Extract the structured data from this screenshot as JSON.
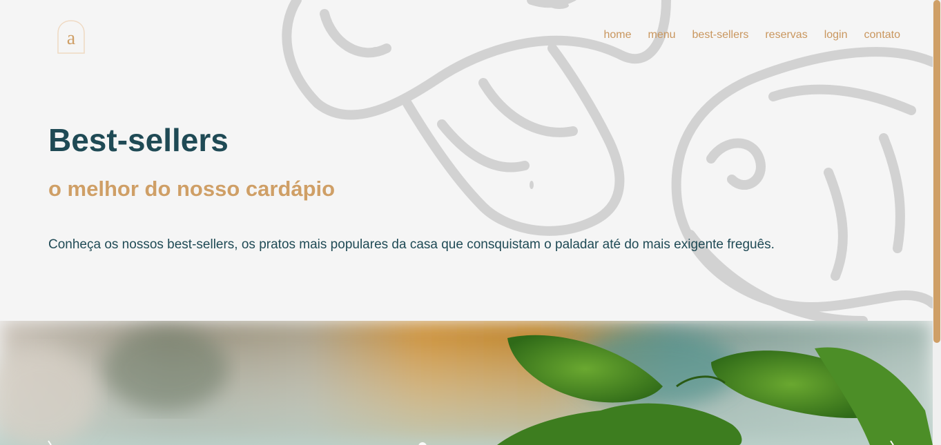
{
  "logo": {
    "letter": "a",
    "icon": "a-monogram-logo-icon"
  },
  "nav": {
    "items": [
      {
        "label": "home"
      },
      {
        "label": "menu"
      },
      {
        "label": "best-sellers"
      },
      {
        "label": "reservas"
      },
      {
        "label": "login"
      },
      {
        "label": "contato"
      }
    ]
  },
  "hero": {
    "title": "Best-sellers",
    "subtitle": "o melhor do nosso cardápio",
    "description": "Conheça os nossos best-sellers, os pratos mais populares da casa que consquistam o paladar até do mais exigente freguês."
  },
  "colors": {
    "accent": "#cf9f66",
    "heading": "#1f4a55",
    "background": "#f5f5f5"
  }
}
